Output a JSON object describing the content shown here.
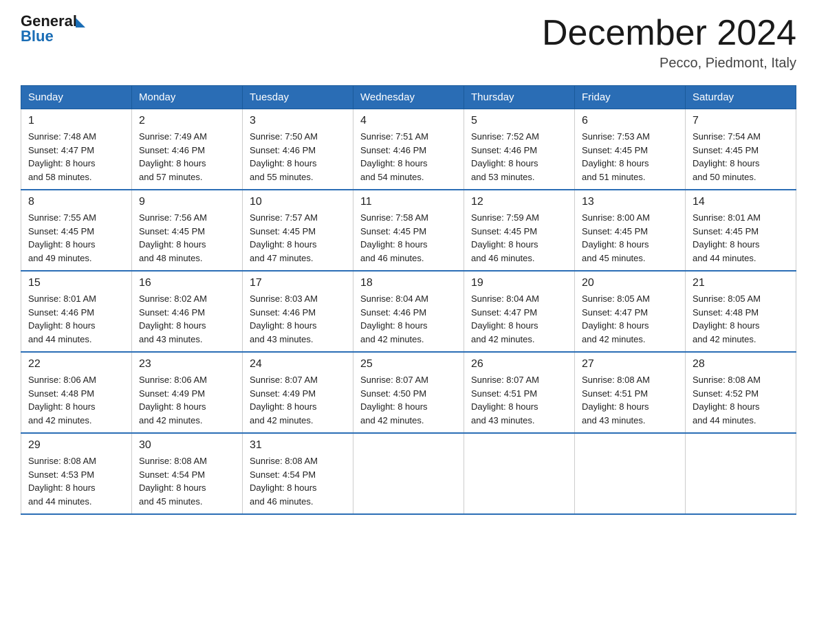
{
  "header": {
    "logo": {
      "general": "General",
      "blue": "Blue"
    },
    "title": "December 2024",
    "location": "Pecco, Piedmont, Italy"
  },
  "days_of_week": [
    "Sunday",
    "Monday",
    "Tuesday",
    "Wednesday",
    "Thursday",
    "Friday",
    "Saturday"
  ],
  "weeks": [
    [
      {
        "day": "1",
        "sunrise": "7:48 AM",
        "sunset": "4:47 PM",
        "daylight": "8 hours and 58 minutes."
      },
      {
        "day": "2",
        "sunrise": "7:49 AM",
        "sunset": "4:46 PM",
        "daylight": "8 hours and 57 minutes."
      },
      {
        "day": "3",
        "sunrise": "7:50 AM",
        "sunset": "4:46 PM",
        "daylight": "8 hours and 55 minutes."
      },
      {
        "day": "4",
        "sunrise": "7:51 AM",
        "sunset": "4:46 PM",
        "daylight": "8 hours and 54 minutes."
      },
      {
        "day": "5",
        "sunrise": "7:52 AM",
        "sunset": "4:46 PM",
        "daylight": "8 hours and 53 minutes."
      },
      {
        "day": "6",
        "sunrise": "7:53 AM",
        "sunset": "4:45 PM",
        "daylight": "8 hours and 51 minutes."
      },
      {
        "day": "7",
        "sunrise": "7:54 AM",
        "sunset": "4:45 PM",
        "daylight": "8 hours and 50 minutes."
      }
    ],
    [
      {
        "day": "8",
        "sunrise": "7:55 AM",
        "sunset": "4:45 PM",
        "daylight": "8 hours and 49 minutes."
      },
      {
        "day": "9",
        "sunrise": "7:56 AM",
        "sunset": "4:45 PM",
        "daylight": "8 hours and 48 minutes."
      },
      {
        "day": "10",
        "sunrise": "7:57 AM",
        "sunset": "4:45 PM",
        "daylight": "8 hours and 47 minutes."
      },
      {
        "day": "11",
        "sunrise": "7:58 AM",
        "sunset": "4:45 PM",
        "daylight": "8 hours and 46 minutes."
      },
      {
        "day": "12",
        "sunrise": "7:59 AM",
        "sunset": "4:45 PM",
        "daylight": "8 hours and 46 minutes."
      },
      {
        "day": "13",
        "sunrise": "8:00 AM",
        "sunset": "4:45 PM",
        "daylight": "8 hours and 45 minutes."
      },
      {
        "day": "14",
        "sunrise": "8:01 AM",
        "sunset": "4:45 PM",
        "daylight": "8 hours and 44 minutes."
      }
    ],
    [
      {
        "day": "15",
        "sunrise": "8:01 AM",
        "sunset": "4:46 PM",
        "daylight": "8 hours and 44 minutes."
      },
      {
        "day": "16",
        "sunrise": "8:02 AM",
        "sunset": "4:46 PM",
        "daylight": "8 hours and 43 minutes."
      },
      {
        "day": "17",
        "sunrise": "8:03 AM",
        "sunset": "4:46 PM",
        "daylight": "8 hours and 43 minutes."
      },
      {
        "day": "18",
        "sunrise": "8:04 AM",
        "sunset": "4:46 PM",
        "daylight": "8 hours and 42 minutes."
      },
      {
        "day": "19",
        "sunrise": "8:04 AM",
        "sunset": "4:47 PM",
        "daylight": "8 hours and 42 minutes."
      },
      {
        "day": "20",
        "sunrise": "8:05 AM",
        "sunset": "4:47 PM",
        "daylight": "8 hours and 42 minutes."
      },
      {
        "day": "21",
        "sunrise": "8:05 AM",
        "sunset": "4:48 PM",
        "daylight": "8 hours and 42 minutes."
      }
    ],
    [
      {
        "day": "22",
        "sunrise": "8:06 AM",
        "sunset": "4:48 PM",
        "daylight": "8 hours and 42 minutes."
      },
      {
        "day": "23",
        "sunrise": "8:06 AM",
        "sunset": "4:49 PM",
        "daylight": "8 hours and 42 minutes."
      },
      {
        "day": "24",
        "sunrise": "8:07 AM",
        "sunset": "4:49 PM",
        "daylight": "8 hours and 42 minutes."
      },
      {
        "day": "25",
        "sunrise": "8:07 AM",
        "sunset": "4:50 PM",
        "daylight": "8 hours and 42 minutes."
      },
      {
        "day": "26",
        "sunrise": "8:07 AM",
        "sunset": "4:51 PM",
        "daylight": "8 hours and 43 minutes."
      },
      {
        "day": "27",
        "sunrise": "8:08 AM",
        "sunset": "4:51 PM",
        "daylight": "8 hours and 43 minutes."
      },
      {
        "day": "28",
        "sunrise": "8:08 AM",
        "sunset": "4:52 PM",
        "daylight": "8 hours and 44 minutes."
      }
    ],
    [
      {
        "day": "29",
        "sunrise": "8:08 AM",
        "sunset": "4:53 PM",
        "daylight": "8 hours and 44 minutes."
      },
      {
        "day": "30",
        "sunrise": "8:08 AM",
        "sunset": "4:54 PM",
        "daylight": "8 hours and 45 minutes."
      },
      {
        "day": "31",
        "sunrise": "8:08 AM",
        "sunset": "4:54 PM",
        "daylight": "8 hours and 46 minutes."
      },
      null,
      null,
      null,
      null
    ]
  ],
  "labels": {
    "sunrise": "Sunrise:",
    "sunset": "Sunset:",
    "daylight": "Daylight:"
  }
}
